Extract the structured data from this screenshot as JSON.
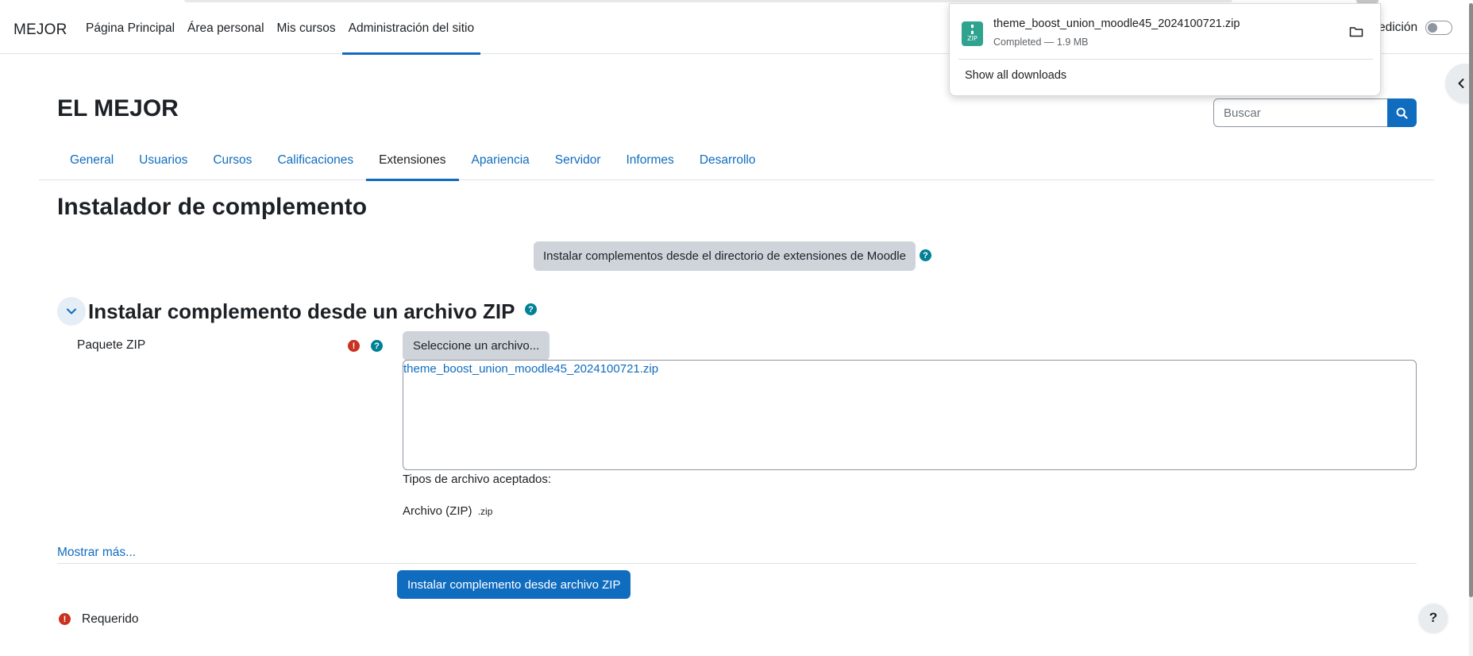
{
  "navbar": {
    "brand": "MEJOR",
    "items": [
      {
        "label": "Página Principal",
        "active": false
      },
      {
        "label": "Área personal",
        "active": false
      },
      {
        "label": "Mis cursos",
        "active": false
      },
      {
        "label": "Administración del sitio",
        "active": true
      }
    ],
    "edit_mode_label": "edición"
  },
  "downloads": {
    "file_name": "theme_boost_union_moodle45_2024100721.zip",
    "status": "Completed — 1.9 MB",
    "icon_label": "ZIP",
    "show_all_label": "Show all downloads"
  },
  "header": {
    "site_title": "EL MEJOR",
    "search_placeholder": "Buscar"
  },
  "secondary_nav": {
    "tabs": [
      {
        "label": "General",
        "active": false
      },
      {
        "label": "Usuarios",
        "active": false
      },
      {
        "label": "Cursos",
        "active": false
      },
      {
        "label": "Calificaciones",
        "active": false
      },
      {
        "label": "Extensiones",
        "active": true
      },
      {
        "label": "Apariencia",
        "active": false
      },
      {
        "label": "Servidor",
        "active": false
      },
      {
        "label": "Informes",
        "active": false
      },
      {
        "label": "Desarrollo",
        "active": false
      }
    ]
  },
  "main": {
    "page_heading": "Instalador de complemento",
    "moodle_directory_button": "Instalar complementos desde el directorio de extensiones de Moodle",
    "section_heading": "Instalar complemento desde un archivo ZIP",
    "field_label": "Paquete ZIP",
    "choose_file_button": "Seleccione un archivo...",
    "selected_file": "theme_boost_union_moodle45_2024100721.zip",
    "accepted_types_label": "Tipos de archivo aceptados:",
    "accepted_type_name": "Archivo (ZIP)",
    "accepted_type_ext": ".zip",
    "show_more": "Mostrar más...",
    "submit_button": "Instalar complemento desde archivo ZIP",
    "required_legend": "Requerido"
  },
  "icons": {
    "help": "?",
    "required": "!",
    "footer_help": "?"
  },
  "colors": {
    "primary": "#0f6cbf",
    "help": "#008196",
    "required": "#ca3120",
    "secondary_button": "#ced4da",
    "zip_icon": "#2fa38e"
  }
}
